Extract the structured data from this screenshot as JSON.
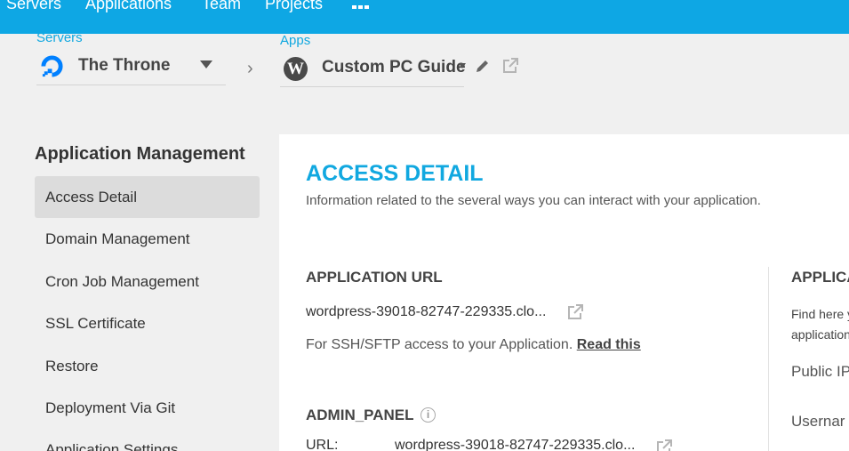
{
  "topnav": {
    "servers": "Servers",
    "applications": "Applications",
    "team": "Team",
    "projects": "Projects",
    "apps_icon": "grid-icon"
  },
  "server_selector": {
    "label": "Servers",
    "name": "The Throne",
    "icon": "digitalocean-icon"
  },
  "app_selector": {
    "label": "Apps",
    "name": "Custom PC Guide",
    "icon": "wordpress-icon"
  },
  "sidebar": {
    "heading": "Application Management",
    "items": [
      {
        "label": "Access Detail",
        "active": true
      },
      {
        "label": "Domain Management"
      },
      {
        "label": "Cron Job Management"
      },
      {
        "label": "SSL Certificate"
      },
      {
        "label": "Restore"
      },
      {
        "label": "Deployment Via Git"
      },
      {
        "label": "Application Settings"
      }
    ]
  },
  "main": {
    "title": "ACCESS DETAIL",
    "description": "Information related to the several ways you can interact with your application.",
    "app_url": {
      "title": "APPLICATION URL",
      "value": "wordpress-39018-82747-229335.clo...",
      "note": "For SSH/SFTP access to your Application.",
      "link": "Read this"
    },
    "admin_panel": {
      "title": "ADMIN_PANEL",
      "url_label": "URL:",
      "url_value": "wordpress-39018-82747-229335.clo..."
    },
    "right": {
      "title": "APPLICA",
      "line1": "Find here y",
      "line2": "application",
      "public_ip": "Public IP",
      "username": "Usernar"
    }
  },
  "colors": {
    "brand": "#0ea7e4",
    "accent": "#11a8e0"
  }
}
